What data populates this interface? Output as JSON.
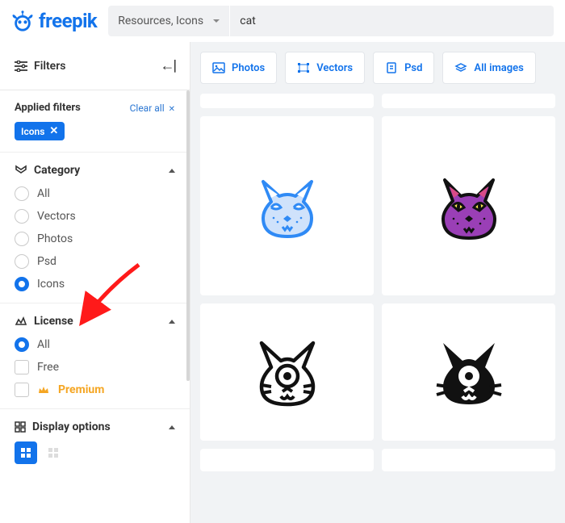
{
  "header": {
    "logo_text": "freepik",
    "resource_selector": "Resources, Icons",
    "search_value": "cat"
  },
  "pills": {
    "photos": "Photos",
    "vectors": "Vectors",
    "psd": "Psd",
    "all": "All images"
  },
  "sidebar": {
    "filters_title": "Filters",
    "back_glyph": "←|",
    "applied_title": "Applied filters",
    "clear_all": "Clear all",
    "chip_label": "Icons",
    "category": {
      "title": "Category",
      "options": {
        "all": "All",
        "vectors": "Vectors",
        "photos": "Photos",
        "psd": "Psd",
        "icons": "Icons"
      }
    },
    "license": {
      "title": "License",
      "options": {
        "all": "All",
        "free": "Free",
        "premium": "Premium"
      }
    },
    "display": {
      "title": "Display options"
    }
  }
}
